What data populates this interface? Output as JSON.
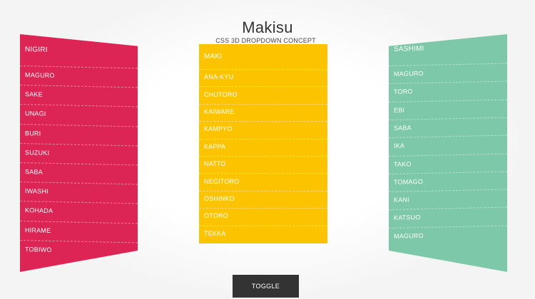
{
  "title": "Makisu",
  "subtitle": "CSS 3D DROPDOWN CONCEPT",
  "colors": {
    "left": "#dc2554",
    "middle": "#fcc400",
    "right": "#7cc8a8",
    "toggle": "#333333"
  },
  "panels": {
    "left": {
      "header": "NIGIRI",
      "items": [
        "MAGURO",
        "SAKE",
        "UNAGI",
        "BURI",
        "SUZUKI",
        "SABA",
        "IWASHI",
        "KOHADA",
        "HIRAME",
        "TOBIWO"
      ]
    },
    "middle": {
      "header": "MAKI",
      "items": [
        "ANA-KYU",
        "CHUTORO",
        "KAIWARE",
        "KAMPYO",
        "KAPPA",
        "NATTO",
        "NEGITORO",
        "OSHINKO",
        "OTORO",
        "TEKKA"
      ]
    },
    "right": {
      "header": "SASHIMI",
      "items": [
        "MAGURO",
        "TORO",
        "EBI",
        "SABA",
        "IKA",
        "TAKO",
        "TOMAGO",
        "KANI",
        "KATSUO",
        "MAGURO"
      ]
    }
  },
  "toggle_label": "TOGGLE"
}
